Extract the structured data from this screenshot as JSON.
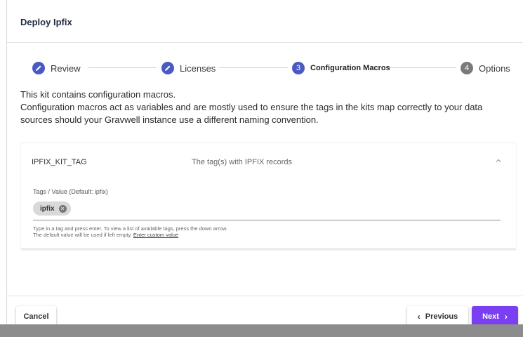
{
  "dialog": {
    "title": "Deploy Ipfix"
  },
  "steps": [
    {
      "number": "",
      "label": "Review",
      "state": "done"
    },
    {
      "number": "",
      "label": "Licenses",
      "state": "done"
    },
    {
      "number": "3",
      "label": "Configuration Macros",
      "state": "active"
    },
    {
      "number": "4",
      "label": "Options",
      "state": "pending"
    }
  ],
  "intro": {
    "line1": "This kit contains configuration macros.",
    "line2": "Configuration macros act as variables and are mostly used to ensure the tags in the kits map correctly to your data sources should your Gravwell instance use a different naming convention."
  },
  "macro": {
    "name": "IPFIX_KIT_TAG",
    "description": "The tag(s) with IPFIX records",
    "field_label": "Tags / Value (Default: ipfix)",
    "chip": "ipfix",
    "hint_line1": "Type in a tag and press enter. To view a list of available tags, press the down arrow.",
    "hint_line2": "The default value will be used if left empty.",
    "hint_link": "Enter custom value"
  },
  "footer": {
    "cancel": "Cancel",
    "previous": "Previous",
    "next": "Next"
  },
  "colors": {
    "accent": "#4a59c3",
    "next_button": "#7a3ff2",
    "pending_step": "#7a7a7a"
  },
  "icons": {
    "done_step": "pencil-icon",
    "collapse": "chevron-up-icon",
    "chip_remove": "close-circle-icon",
    "prev": "chevron-left-icon",
    "next": "chevron-right-icon"
  }
}
